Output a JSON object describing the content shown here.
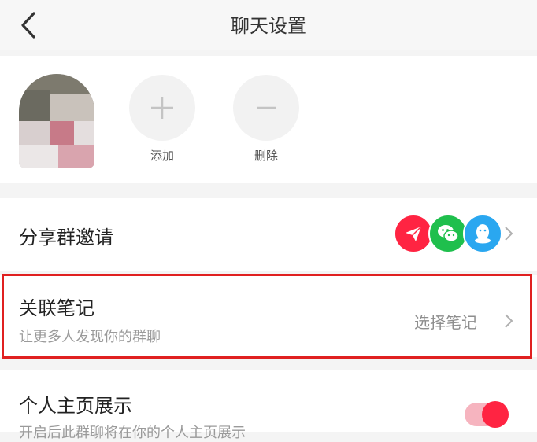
{
  "header": {
    "title": "聊天设置"
  },
  "members": {
    "add_label": "添加",
    "remove_label": "删除"
  },
  "share_row": {
    "label": "分享群邀请"
  },
  "note_row": {
    "title": "关联笔记",
    "subtitle": "让更多人发现你的群聊",
    "action": "选择笔记"
  },
  "profile_row": {
    "title": "个人主页展示",
    "subtitle": "开启后此群聊将在你的个人主页展示",
    "enabled": true
  },
  "colors": {
    "accent": "#ff2442",
    "highlight_border": "#e02020",
    "wechat": "#1fbf4d",
    "qq": "#2aa7f0"
  }
}
